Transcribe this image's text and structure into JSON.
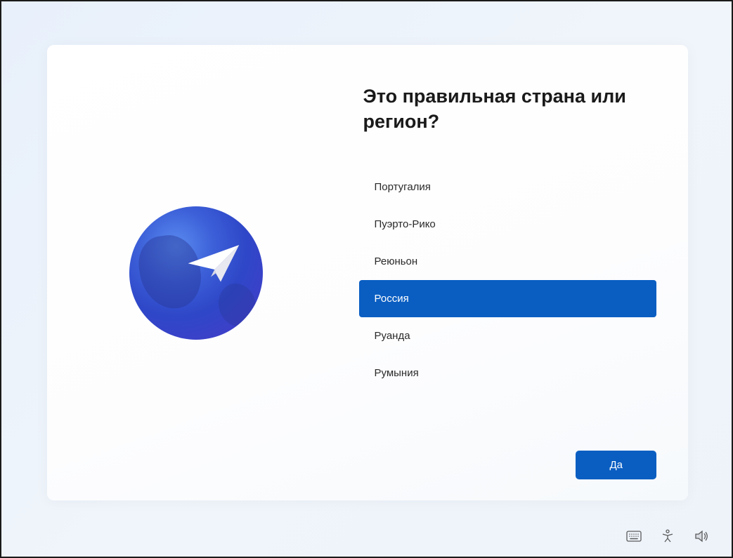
{
  "heading": "Это правильная страна или регион?",
  "countries": [
    {
      "label": "Португалия",
      "selected": false
    },
    {
      "label": "Пуэрто-Рико",
      "selected": false
    },
    {
      "label": "Реюньон",
      "selected": false
    },
    {
      "label": "Россия",
      "selected": true
    },
    {
      "label": "Руанда",
      "selected": false
    },
    {
      "label": "Румыния",
      "selected": false
    }
  ],
  "confirm_button": "Да",
  "colors": {
    "primary": "#0a5ec2",
    "text": "#1a1a1a"
  }
}
